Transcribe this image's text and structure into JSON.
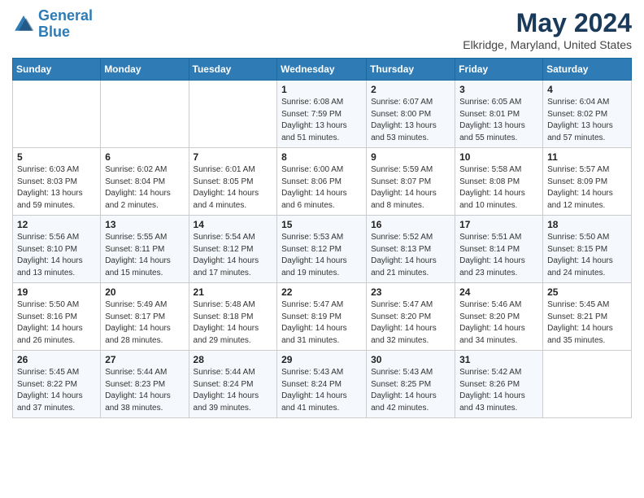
{
  "logo": {
    "line1": "General",
    "line2": "Blue"
  },
  "title": "May 2024",
  "location": "Elkridge, Maryland, United States",
  "weekdays": [
    "Sunday",
    "Monday",
    "Tuesday",
    "Wednesday",
    "Thursday",
    "Friday",
    "Saturday"
  ],
  "weeks": [
    [
      {
        "day": "",
        "sunrise": "",
        "sunset": "",
        "daylight": ""
      },
      {
        "day": "",
        "sunrise": "",
        "sunset": "",
        "daylight": ""
      },
      {
        "day": "",
        "sunrise": "",
        "sunset": "",
        "daylight": ""
      },
      {
        "day": "1",
        "sunrise": "Sunrise: 6:08 AM",
        "sunset": "Sunset: 7:59 PM",
        "daylight": "Daylight: 13 hours and 51 minutes."
      },
      {
        "day": "2",
        "sunrise": "Sunrise: 6:07 AM",
        "sunset": "Sunset: 8:00 PM",
        "daylight": "Daylight: 13 hours and 53 minutes."
      },
      {
        "day": "3",
        "sunrise": "Sunrise: 6:05 AM",
        "sunset": "Sunset: 8:01 PM",
        "daylight": "Daylight: 13 hours and 55 minutes."
      },
      {
        "day": "4",
        "sunrise": "Sunrise: 6:04 AM",
        "sunset": "Sunset: 8:02 PM",
        "daylight": "Daylight: 13 hours and 57 minutes."
      }
    ],
    [
      {
        "day": "5",
        "sunrise": "Sunrise: 6:03 AM",
        "sunset": "Sunset: 8:03 PM",
        "daylight": "Daylight: 13 hours and 59 minutes."
      },
      {
        "day": "6",
        "sunrise": "Sunrise: 6:02 AM",
        "sunset": "Sunset: 8:04 PM",
        "daylight": "Daylight: 14 hours and 2 minutes."
      },
      {
        "day": "7",
        "sunrise": "Sunrise: 6:01 AM",
        "sunset": "Sunset: 8:05 PM",
        "daylight": "Daylight: 14 hours and 4 minutes."
      },
      {
        "day": "8",
        "sunrise": "Sunrise: 6:00 AM",
        "sunset": "Sunset: 8:06 PM",
        "daylight": "Daylight: 14 hours and 6 minutes."
      },
      {
        "day": "9",
        "sunrise": "Sunrise: 5:59 AM",
        "sunset": "Sunset: 8:07 PM",
        "daylight": "Daylight: 14 hours and 8 minutes."
      },
      {
        "day": "10",
        "sunrise": "Sunrise: 5:58 AM",
        "sunset": "Sunset: 8:08 PM",
        "daylight": "Daylight: 14 hours and 10 minutes."
      },
      {
        "day": "11",
        "sunrise": "Sunrise: 5:57 AM",
        "sunset": "Sunset: 8:09 PM",
        "daylight": "Daylight: 14 hours and 12 minutes."
      }
    ],
    [
      {
        "day": "12",
        "sunrise": "Sunrise: 5:56 AM",
        "sunset": "Sunset: 8:10 PM",
        "daylight": "Daylight: 14 hours and 13 minutes."
      },
      {
        "day": "13",
        "sunrise": "Sunrise: 5:55 AM",
        "sunset": "Sunset: 8:11 PM",
        "daylight": "Daylight: 14 hours and 15 minutes."
      },
      {
        "day": "14",
        "sunrise": "Sunrise: 5:54 AM",
        "sunset": "Sunset: 8:12 PM",
        "daylight": "Daylight: 14 hours and 17 minutes."
      },
      {
        "day": "15",
        "sunrise": "Sunrise: 5:53 AM",
        "sunset": "Sunset: 8:12 PM",
        "daylight": "Daylight: 14 hours and 19 minutes."
      },
      {
        "day": "16",
        "sunrise": "Sunrise: 5:52 AM",
        "sunset": "Sunset: 8:13 PM",
        "daylight": "Daylight: 14 hours and 21 minutes."
      },
      {
        "day": "17",
        "sunrise": "Sunrise: 5:51 AM",
        "sunset": "Sunset: 8:14 PM",
        "daylight": "Daylight: 14 hours and 23 minutes."
      },
      {
        "day": "18",
        "sunrise": "Sunrise: 5:50 AM",
        "sunset": "Sunset: 8:15 PM",
        "daylight": "Daylight: 14 hours and 24 minutes."
      }
    ],
    [
      {
        "day": "19",
        "sunrise": "Sunrise: 5:50 AM",
        "sunset": "Sunset: 8:16 PM",
        "daylight": "Daylight: 14 hours and 26 minutes."
      },
      {
        "day": "20",
        "sunrise": "Sunrise: 5:49 AM",
        "sunset": "Sunset: 8:17 PM",
        "daylight": "Daylight: 14 hours and 28 minutes."
      },
      {
        "day": "21",
        "sunrise": "Sunrise: 5:48 AM",
        "sunset": "Sunset: 8:18 PM",
        "daylight": "Daylight: 14 hours and 29 minutes."
      },
      {
        "day": "22",
        "sunrise": "Sunrise: 5:47 AM",
        "sunset": "Sunset: 8:19 PM",
        "daylight": "Daylight: 14 hours and 31 minutes."
      },
      {
        "day": "23",
        "sunrise": "Sunrise: 5:47 AM",
        "sunset": "Sunset: 8:20 PM",
        "daylight": "Daylight: 14 hours and 32 minutes."
      },
      {
        "day": "24",
        "sunrise": "Sunrise: 5:46 AM",
        "sunset": "Sunset: 8:20 PM",
        "daylight": "Daylight: 14 hours and 34 minutes."
      },
      {
        "day": "25",
        "sunrise": "Sunrise: 5:45 AM",
        "sunset": "Sunset: 8:21 PM",
        "daylight": "Daylight: 14 hours and 35 minutes."
      }
    ],
    [
      {
        "day": "26",
        "sunrise": "Sunrise: 5:45 AM",
        "sunset": "Sunset: 8:22 PM",
        "daylight": "Daylight: 14 hours and 37 minutes."
      },
      {
        "day": "27",
        "sunrise": "Sunrise: 5:44 AM",
        "sunset": "Sunset: 8:23 PM",
        "daylight": "Daylight: 14 hours and 38 minutes."
      },
      {
        "day": "28",
        "sunrise": "Sunrise: 5:44 AM",
        "sunset": "Sunset: 8:24 PM",
        "daylight": "Daylight: 14 hours and 39 minutes."
      },
      {
        "day": "29",
        "sunrise": "Sunrise: 5:43 AM",
        "sunset": "Sunset: 8:24 PM",
        "daylight": "Daylight: 14 hours and 41 minutes."
      },
      {
        "day": "30",
        "sunrise": "Sunrise: 5:43 AM",
        "sunset": "Sunset: 8:25 PM",
        "daylight": "Daylight: 14 hours and 42 minutes."
      },
      {
        "day": "31",
        "sunrise": "Sunrise: 5:42 AM",
        "sunset": "Sunset: 8:26 PM",
        "daylight": "Daylight: 14 hours and 43 minutes."
      },
      {
        "day": "",
        "sunrise": "",
        "sunset": "",
        "daylight": ""
      }
    ]
  ]
}
